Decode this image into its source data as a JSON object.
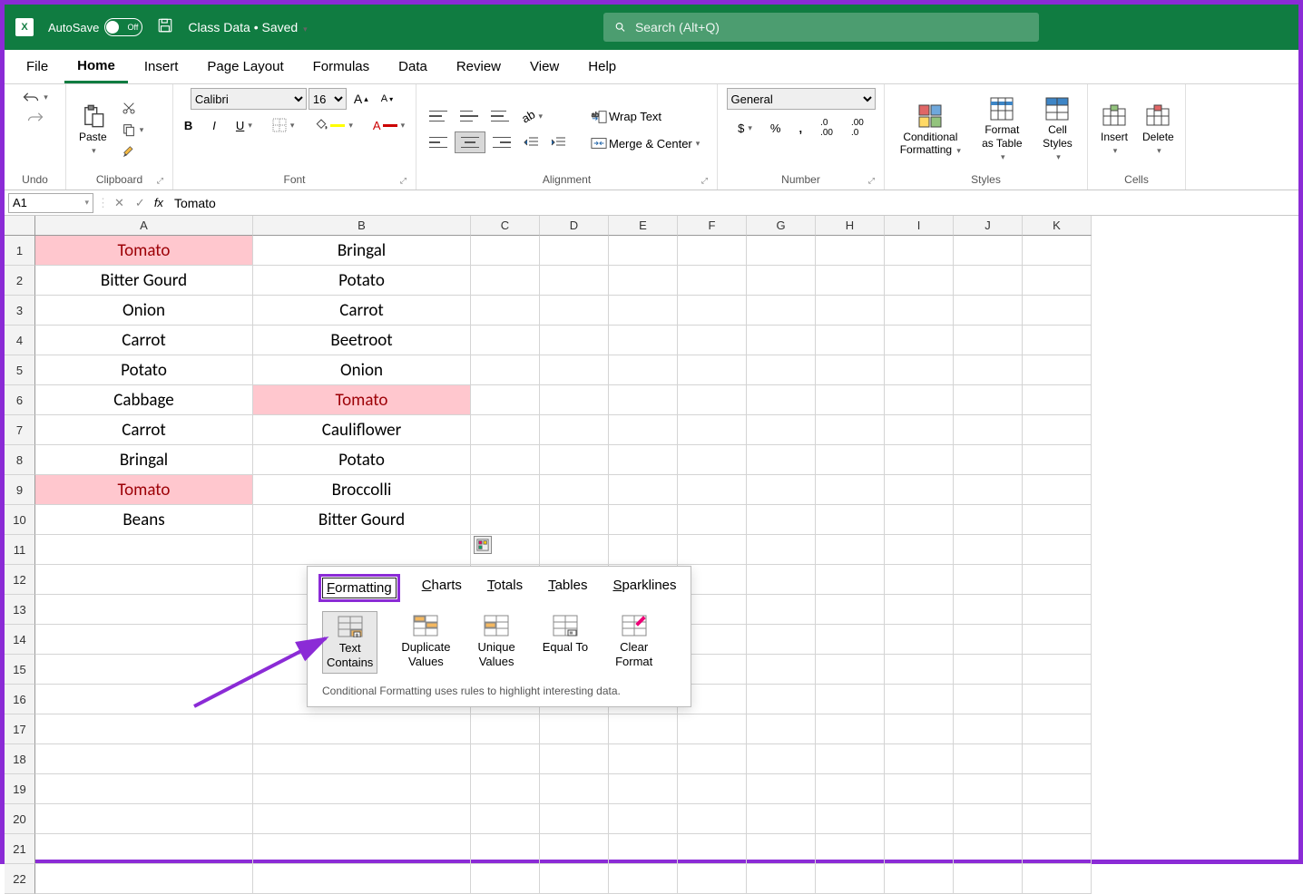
{
  "titlebar": {
    "autosave_label": "AutoSave",
    "autosave_state": "Off",
    "doc_name": "Class Data • Saved",
    "search_placeholder": "Search (Alt+Q)"
  },
  "tabs": [
    "File",
    "Home",
    "Insert",
    "Page Layout",
    "Formulas",
    "Data",
    "Review",
    "View",
    "Help"
  ],
  "active_tab": "Home",
  "ribbon": {
    "undo_group": "Undo",
    "clipboard_group": "Clipboard",
    "paste": "Paste",
    "font_group": "Font",
    "font_name": "Calibri",
    "font_size": "16",
    "alignment_group": "Alignment",
    "wrap_text": "Wrap Text",
    "merge_center": "Merge & Center",
    "number_group": "Number",
    "number_format": "General",
    "styles_group": "Styles",
    "cond_fmt": "Conditional Formatting",
    "fmt_table": "Format as Table",
    "cell_styles": "Cell Styles",
    "cells_group": "Cells",
    "insert": "Insert",
    "delete": "Delete"
  },
  "namebox": "A1",
  "formula": "Tomato",
  "columns": [
    "A",
    "B",
    "C",
    "D",
    "E",
    "F",
    "G",
    "H",
    "I",
    "J",
    "K"
  ],
  "rows_count": 22,
  "data_col_a": [
    "Tomato",
    "Bitter Gourd",
    "Onion",
    "Carrot",
    "Potato",
    "Cabbage",
    "Carrot",
    "Bringal",
    "Tomato",
    "Beans"
  ],
  "data_col_b": [
    "Bringal",
    "Potato",
    "Carrot",
    "Beetroot",
    "Onion",
    "Tomato",
    "Cauliflower",
    "Potato",
    "Broccolli",
    "Bitter Gourd"
  ],
  "highlighted": {
    "A1": true,
    "A9": true,
    "B6": true
  },
  "popup": {
    "tabs": [
      "Formatting",
      "Charts",
      "Totals",
      "Tables",
      "Sparklines"
    ],
    "active": "Formatting",
    "options": [
      {
        "line1": "Text",
        "line2": "Contains"
      },
      {
        "line1": "Duplicate",
        "line2": "Values"
      },
      {
        "line1": "Unique",
        "line2": "Values"
      },
      {
        "line1": "Equal To",
        "line2": ""
      },
      {
        "line1": "Clear",
        "line2": "Format"
      }
    ],
    "hint": "Conditional Formatting uses rules to highlight interesting data."
  }
}
